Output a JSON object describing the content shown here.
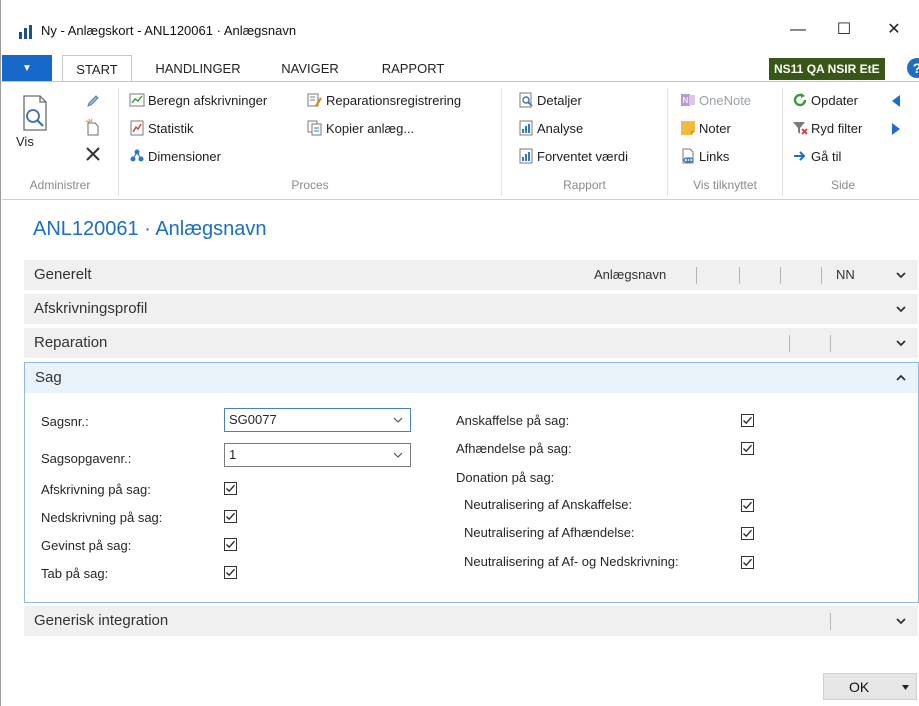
{
  "window": {
    "title": "Ny - Anlægskort - ANL120061 · Anlægsnavn",
    "minimize_glyph": "—",
    "maximize_glyph": "☐",
    "close_glyph": "✕"
  },
  "ribbon_tabs": {
    "file_glyph": "▼",
    "start": "START",
    "handlinger": "HANDLINGER",
    "naviger": "NAVIGER",
    "rapport": "RAPPORT"
  },
  "company_badge": "NS11 QA NSIR EtE",
  "help_glyph": "?",
  "ribbon": {
    "administrer": {
      "label": "Administrer",
      "vis": "Vis"
    },
    "proces": {
      "label": "Proces",
      "beregn": "Beregn afskrivninger",
      "statistik": "Statistik",
      "dimensioner": "Dimensioner",
      "reparation": "Reparationsregistrering",
      "kopier": "Kopier anlæg..."
    },
    "rapport": {
      "label": "Rapport",
      "detaljer": "Detaljer",
      "analyse": "Analyse",
      "forventet": "Forventet værdi"
    },
    "vis_tilknyttet": {
      "label": "Vis tilknyttet",
      "onenote": "OneNote",
      "noter": "Noter",
      "links": "Links"
    },
    "side": {
      "label": "Side",
      "opdater": "Opdater",
      "ryd_filter": "Ryd filter",
      "gaa_til": "Gå til"
    }
  },
  "page_title": "ANL120061 · Anlægsnavn",
  "fasttabs": {
    "generelt": {
      "label": "Generelt",
      "summary_name": "Anlægsnavn",
      "summary_code": "NN"
    },
    "afskrivningsprofil": {
      "label": "Afskrivningsprofil"
    },
    "reparation": {
      "label": "Reparation"
    },
    "sag": {
      "label": "Sag"
    },
    "generisk": {
      "label": "Generisk integration"
    }
  },
  "sag": {
    "sagsnr_label": "Sagsnr.:",
    "sagsnr_value": "SG0077",
    "sagsopgave_label": "Sagsopgavenr.:",
    "sagsopgave_value": "1",
    "afskrivning_label": "Afskrivning på sag:",
    "afskrivning_checked": true,
    "nedskrivning_label": "Nedskrivning på sag:",
    "nedskrivning_checked": true,
    "gevinst_label": "Gevinst på sag:",
    "gevinst_checked": true,
    "tab_label": "Tab på sag:",
    "tab_checked": true,
    "anskaffelse_label": "Anskaffelse på sag:",
    "anskaffelse_checked": true,
    "afhaendelse_label": "Afhændelse på sag:",
    "afhaendelse_checked": true,
    "donation_label": "Donation på sag:",
    "neutral_anskaffelse_label": "Neutralisering af Anskaffelse:",
    "neutral_anskaffelse_checked": true,
    "neutral_afhaendelse_label": "Neutralisering af Afhændelse:",
    "neutral_afhaendelse_checked": true,
    "neutral_afned_label": "Neutralisering af Af- og Nedskrivning:",
    "neutral_afned_checked": true
  },
  "footer": {
    "ok": "OK"
  },
  "colors": {
    "accent": "#1a6fc4",
    "company_badge_bg": "#375717",
    "file_tab_bg": "#1769c9"
  }
}
